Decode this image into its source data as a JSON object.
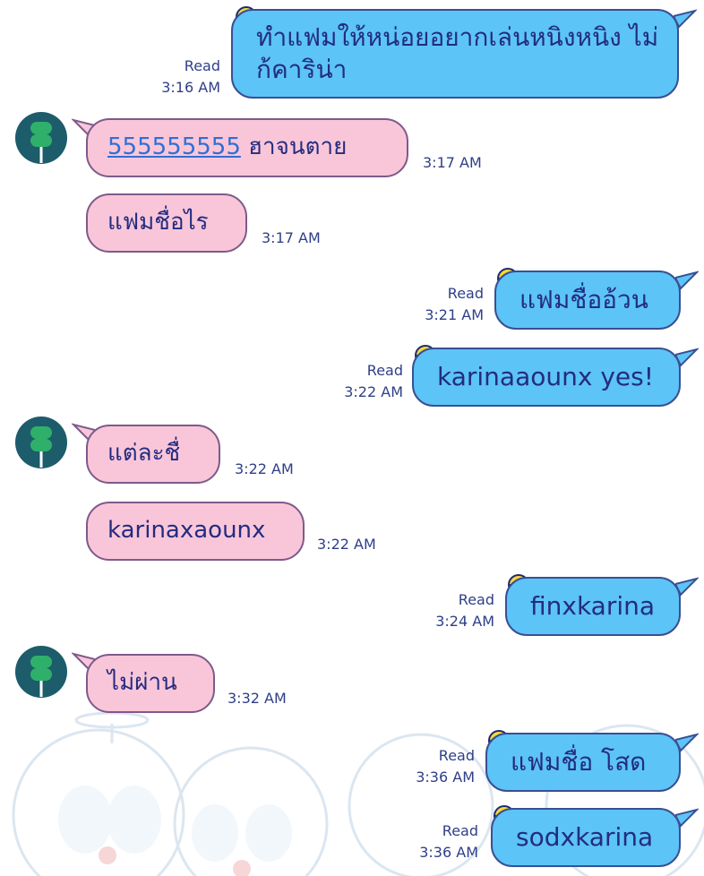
{
  "theme": {
    "outgoing_bubble": "#5cc4f7",
    "incoming_bubble": "#f9c6d9",
    "text": "#232c80",
    "link": "#2f6fd4"
  },
  "messages": [
    {
      "direction": "out",
      "read_label": "Read",
      "time": "3:16 AM",
      "text": "ทำแฟมให้หน่อยอยากเล่นหนิงหนิง ไม่ก้คาริน่า"
    },
    {
      "direction": "in",
      "time": "3:17 AM",
      "link_text": "555555555",
      "text": " ฮาจนตาย",
      "avatar_icon": "green-lollipop-avatar-icon"
    },
    {
      "direction": "in",
      "time": "3:17 AM",
      "text": "แฟมชื่อไร"
    },
    {
      "direction": "out",
      "read_label": "Read",
      "time": "3:21 AM",
      "text": "แฟมชื่ออ้วน"
    },
    {
      "direction": "out",
      "read_label": "Read",
      "time": "3:22 AM",
      "text": "karinaaounx yes!"
    },
    {
      "direction": "in",
      "time": "3:22 AM",
      "text": "แต่ละชื่",
      "avatar_icon": "green-lollipop-avatar-icon"
    },
    {
      "direction": "in",
      "time": "3:22 AM",
      "text": "karinaxaounx"
    },
    {
      "direction": "out",
      "read_label": "Read",
      "time": "3:24 AM",
      "text": "finxkarina"
    },
    {
      "direction": "in",
      "time": "3:32 AM",
      "text": "ไม่ผ่าน",
      "avatar_icon": "green-lollipop-avatar-icon"
    },
    {
      "direction": "out",
      "read_label": "Read",
      "time": "3:36 AM",
      "text": "แฟมชื่อ โสด"
    },
    {
      "direction": "out",
      "read_label": "Read",
      "time": "3:36 AM",
      "text": "sodxkarina"
    }
  ]
}
